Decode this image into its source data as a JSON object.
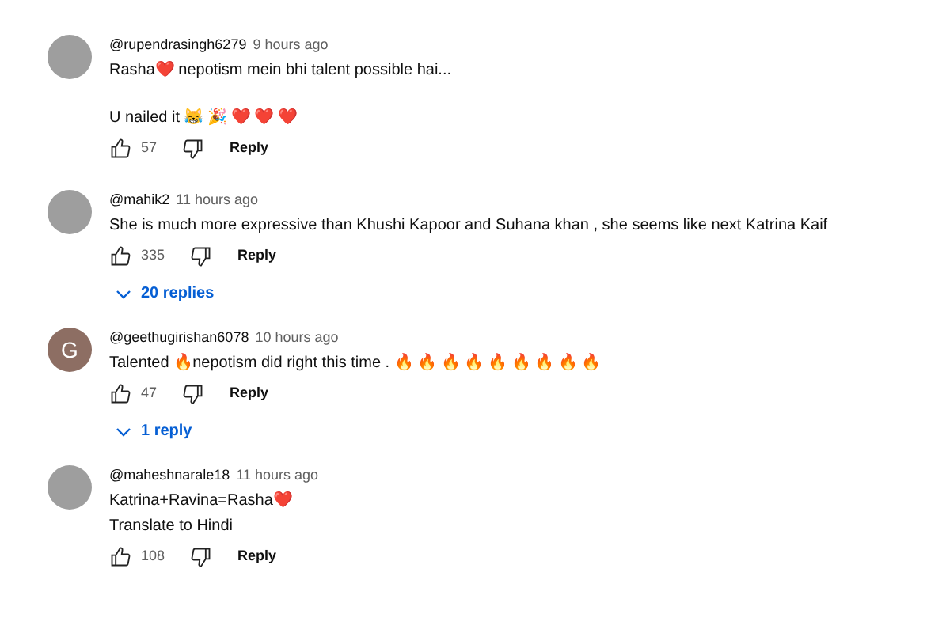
{
  "comments": [
    {
      "kind": "photo",
      "author": "@rupendrasingh6279",
      "time": "9 hours ago",
      "paragraphs": [
        "Rasha❤️ nepotism mein bhi talent possible hai...",
        "U nailed it 😹 🎉 ❤️ ❤️ ❤️"
      ],
      "likes": "57",
      "reply": "Reply"
    },
    {
      "kind": "photo",
      "author": "@mahik2",
      "time": "11 hours ago",
      "paragraphs": [
        "She is much more expressive than Khushi Kapoor and Suhana khan , she seems like next Katrina Kaif"
      ],
      "likes": "335",
      "reply": "Reply",
      "replies": "20 replies"
    },
    {
      "kind": "letter",
      "letter": "G",
      "color": "#8d6e63",
      "author": "@geethugirishan6078",
      "time": "10 hours ago",
      "paragraphs": [
        "Talented 🔥nepotism did right this time . 🔥 🔥 🔥 🔥 🔥 🔥 🔥 🔥 🔥"
      ],
      "likes": "47",
      "reply": "Reply",
      "replies": "1 reply"
    },
    {
      "kind": "photo",
      "author": "@maheshnarale18",
      "time": "11 hours ago",
      "paragraphs": [
        "Katrina+Ravina=Rasha❤️"
      ],
      "translate": "Translate to Hindi",
      "likes": "108",
      "reply": "Reply"
    }
  ]
}
